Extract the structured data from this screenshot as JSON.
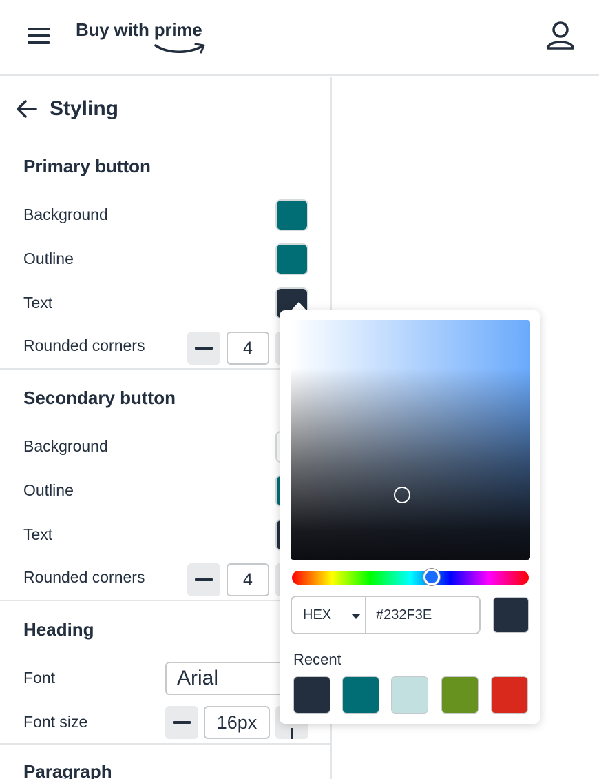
{
  "header": {
    "logo_text": "Buy with prime",
    "menu_icon": "hamburger-menu-icon",
    "user_icon": "user-account-icon"
  },
  "page": {
    "title": "Styling",
    "back_icon": "arrow-left-icon"
  },
  "primary_button": {
    "title": "Primary button",
    "background_label": "Background",
    "background_color": "#006E74",
    "outline_label": "Outline",
    "outline_color": "#006E74",
    "text_label": "Text",
    "text_color": "#232F3E",
    "corners_label": "Rounded corners",
    "corners_value": "4"
  },
  "secondary_button": {
    "title": "Secondary button",
    "background_label": "Background",
    "background_color": "#FFFFFF",
    "outline_label": "Outline",
    "outline_color": "#006E74",
    "text_label": "Text",
    "text_color": "#232F3E",
    "corners_label": "Rounded corners",
    "corners_value": "4"
  },
  "heading": {
    "title": "Heading",
    "font_label": "Font",
    "font_value": "Arial",
    "font_size_label": "Font size",
    "font_size_value": "16px"
  },
  "paragraph": {
    "title": "Paragraph"
  },
  "color_picker": {
    "format": "HEX",
    "hex_value": "#232F3E",
    "preview_color": "#232F3E",
    "recent_label": "Recent",
    "recent_colors": [
      "#232F3E",
      "#006E74",
      "#C2E0DF",
      "#67921F",
      "#D9291C"
    ]
  }
}
